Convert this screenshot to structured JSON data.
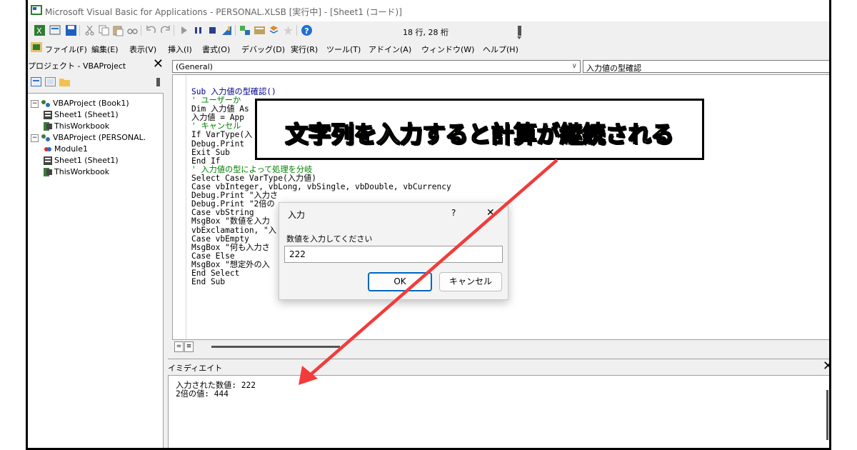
{
  "window": {
    "title": "Microsoft Visual Basic for Applications - PERSONAL.XLSB [実行中] - [Sheet1 (コード)]"
  },
  "toolbar": {
    "position": "18 行, 28 桁"
  },
  "menu": [
    "ファイル(F)",
    "編集(E)",
    "表示(V)",
    "挿入(I)",
    "書式(O)",
    "デバッグ(D)",
    "実行(R)",
    "ツール(T)",
    "アドイン(A)",
    "ウィンドウ(W)",
    "ヘルプ(H)"
  ],
  "project": {
    "title": "プロジェクト - VBAProject",
    "close": "✕",
    "tree": [
      {
        "label": "VBAProject (Book1)",
        "level": 0,
        "icon": "project-icon"
      },
      {
        "label": "Sheet1 (Sheet1)",
        "level": 1,
        "icon": "sheet-icon"
      },
      {
        "label": "ThisWorkbook",
        "level": 1,
        "icon": "workbook-icon"
      },
      {
        "label": "VBAProject (PERSONAL.",
        "level": 0,
        "icon": "project-icon"
      },
      {
        "label": "Module1",
        "level": 1,
        "icon": "module-icon"
      },
      {
        "label": "Sheet1 (Sheet1)",
        "level": 1,
        "icon": "sheet-icon"
      },
      {
        "label": "ThisWorkbook",
        "level": 1,
        "icon": "workbook-icon"
      }
    ]
  },
  "code": {
    "object_combo": "(General)",
    "proc_combo": "入力値の型確認",
    "lines": [
      {
        "t": "Sub 入力値の型確認()",
        "c": "kw"
      },
      {
        "t": "' ユーザーか",
        "c": "cm"
      },
      {
        "t": "Dim 入力値 As",
        "c": ""
      },
      {
        "t": "入力値 = App",
        "c": ""
      },
      {
        "t": "' キャンセル",
        "c": "cm"
      },
      {
        "t": "If VarType(入",
        "c": ""
      },
      {
        "t": "Debug.Print",
        "c": ""
      },
      {
        "t": "Exit Sub",
        "c": ""
      },
      {
        "t": "End If",
        "c": ""
      },
      {
        "t": "' 入力値の型によって処理を分岐",
        "c": "cm"
      },
      {
        "t": "Select Case VarType(入力値)",
        "c": ""
      },
      {
        "t": "Case vbInteger, vbLong, vbSingle, vbDouble, vbCurrency",
        "c": ""
      },
      {
        "t": "Debug.Print \"入力さ",
        "c": ""
      },
      {
        "t": "Debug.Print \"2倍の",
        "c": ""
      },
      {
        "t": "Case vbString",
        "c": ""
      },
      {
        "t": "MsgBox \"数値を入力                              できません。\", _",
        "c": ""
      },
      {
        "t": "vbExclamation, \"入",
        "c": ""
      },
      {
        "t": "Case vbEmpty",
        "c": ""
      },
      {
        "t": "MsgBox \"何も入力さ",
        "c": ""
      },
      {
        "t": "Case Else",
        "c": ""
      },
      {
        "t": "MsgBox \"想定外の入",
        "c": ""
      },
      {
        "t": "End Select",
        "c": ""
      },
      {
        "t": "End Sub",
        "c": ""
      }
    ]
  },
  "immediate": {
    "title": "イミディエイト",
    "close": "✕",
    "output": "入力された数値: 222\n2倍の値: 444"
  },
  "dialog": {
    "title": "入力",
    "help": "?",
    "close": "✕",
    "prompt": "数値を入力してください",
    "value": "222",
    "ok": "OK",
    "cancel": "キャンセル"
  },
  "callout": {
    "text": "文字列を入力すると計算が継続される",
    "text_color": "#ffd23f",
    "arrow_color": "#f23b3b"
  }
}
